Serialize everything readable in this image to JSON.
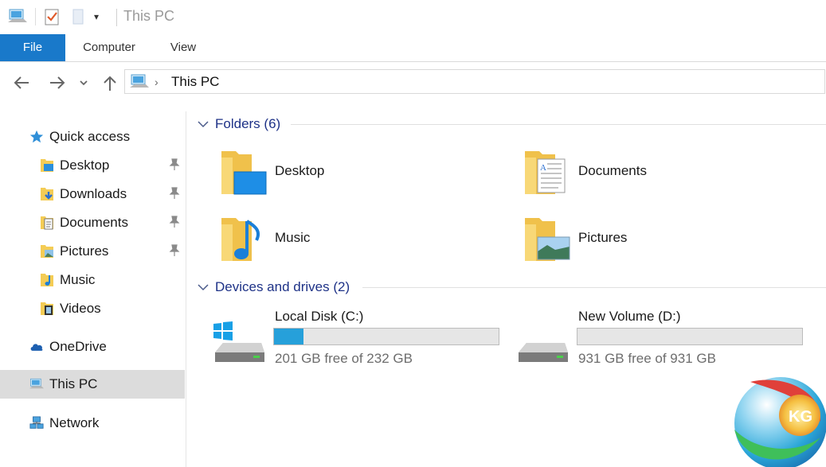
{
  "window": {
    "title": "This PC"
  },
  "ribbon": {
    "tabs": [
      "File",
      "Computer",
      "View"
    ]
  },
  "address": {
    "path": "This PC"
  },
  "sidebar": {
    "quick_access": "Quick access",
    "items": [
      {
        "label": "Desktop",
        "pinned": true
      },
      {
        "label": "Downloads",
        "pinned": true
      },
      {
        "label": "Documents",
        "pinned": true
      },
      {
        "label": "Pictures",
        "pinned": true
      },
      {
        "label": "Music",
        "pinned": false
      },
      {
        "label": "Videos",
        "pinned": false
      }
    ],
    "onedrive": "OneDrive",
    "this_pc": "This PC",
    "network": "Network"
  },
  "folders": {
    "header": "Folders (6)",
    "items": [
      "Desktop",
      "Documents",
      "Music",
      "Pictures"
    ]
  },
  "drives": {
    "header": "Devices and drives (2)",
    "items": [
      {
        "name": "Local Disk (C:)",
        "free_text": "201 GB free of 232 GB",
        "used_fraction": 0.13
      },
      {
        "name": "New Volume (D:)",
        "free_text": "931 GB free of 931 GB",
        "used_fraction": 0.0
      }
    ]
  },
  "watermark": "KG",
  "colors": {
    "accent": "#1979ca",
    "group_header": "#1e3287",
    "drive_fill": "#26a0da",
    "selection": "#dcdcdc"
  }
}
